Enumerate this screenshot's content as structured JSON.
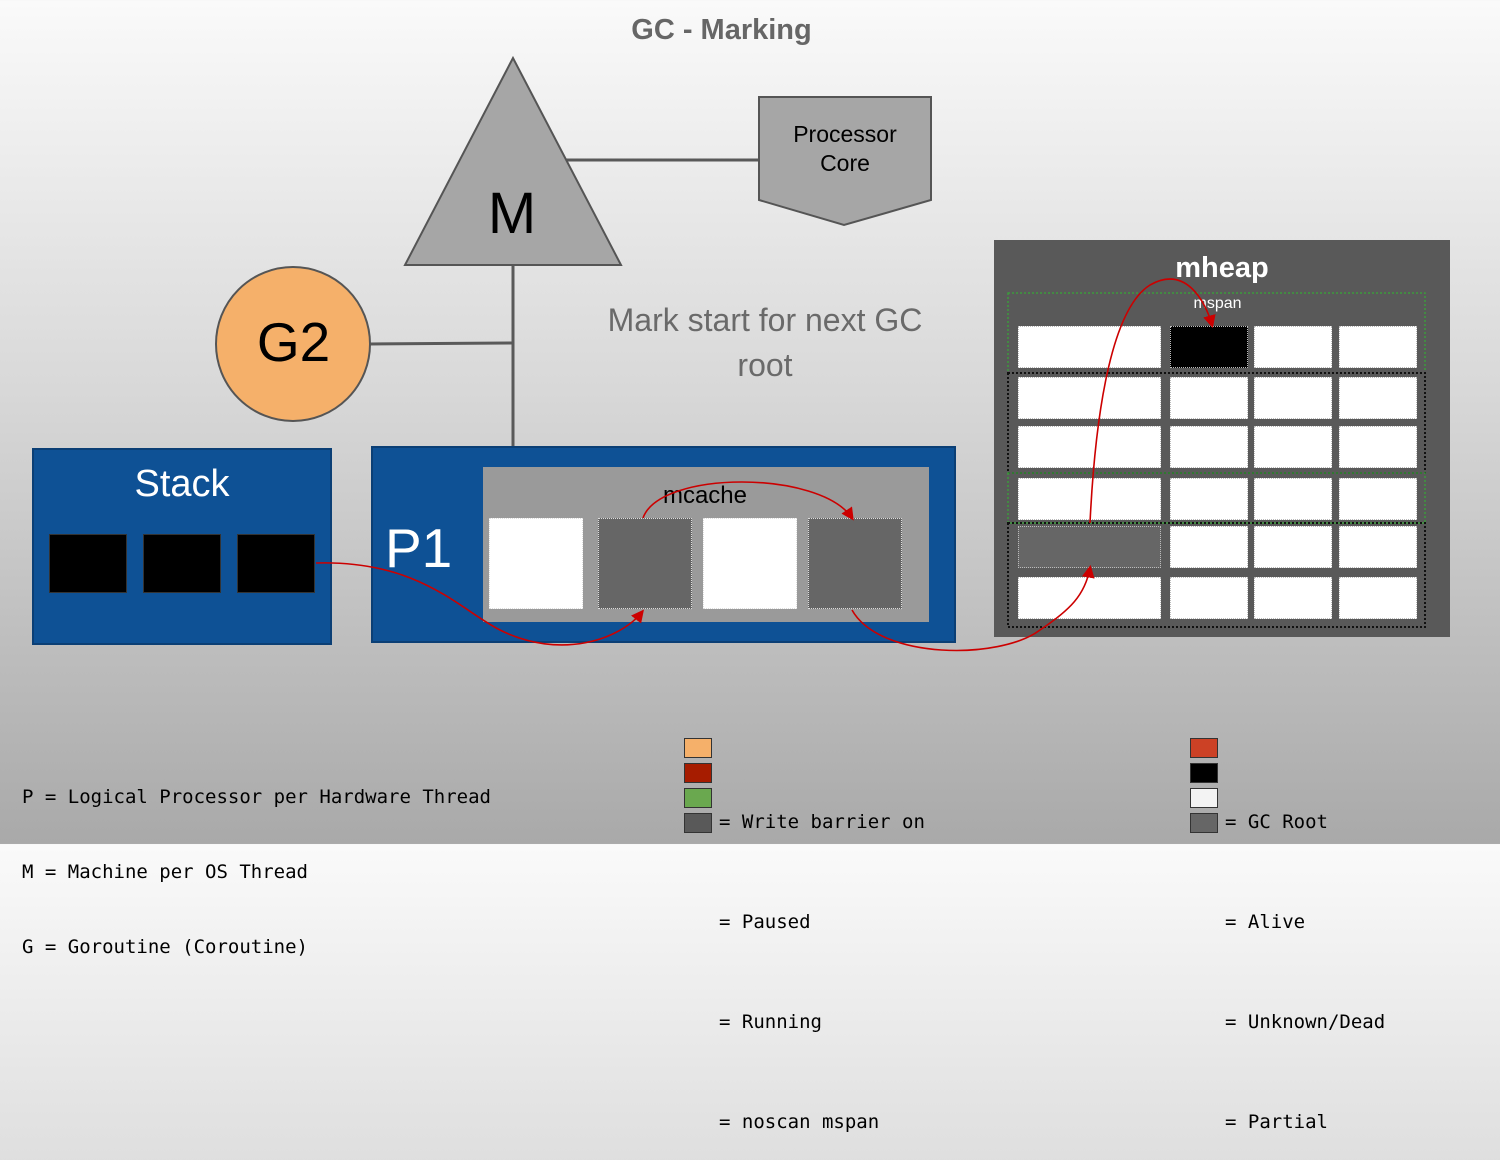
{
  "title": "GC - Marking",
  "processor": {
    "line1": "Processor",
    "line2": "Core"
  },
  "machine": {
    "label": "M"
  },
  "goroutine": {
    "label": "G2",
    "color": "#f5b06a"
  },
  "mark_text": {
    "line1": "Mark start for next GC",
    "line2": "root"
  },
  "stack": {
    "label": "Stack",
    "frames": [
      "#000000",
      "#000000",
      "#000000"
    ]
  },
  "processor_p": {
    "label": "P1"
  },
  "mcache": {
    "label": "mcache",
    "cells": [
      "#ffffff",
      "#666666",
      "#ffffff",
      "#666666"
    ]
  },
  "mheap": {
    "label": "mheap",
    "mspan_label": "mspan",
    "rows": [
      [
        "#ffffff",
        "#000000",
        "#ffffff",
        "#ffffff"
      ],
      [
        "#ffffff",
        "#ffffff",
        "#ffffff",
        "#ffffff"
      ],
      [
        "#ffffff",
        "#ffffff",
        "#ffffff",
        "#ffffff"
      ],
      [
        "#ffffff",
        "#ffffff",
        "#ffffff",
        "#ffffff"
      ],
      [
        "#666666",
        "#ffffff",
        "#ffffff",
        "#ffffff"
      ],
      [
        "#ffffff",
        "#ffffff",
        "#ffffff",
        "#ffffff"
      ]
    ]
  },
  "legend": {
    "definitions": [
      "P = Logical Processor per Hardware Thread",
      "M = Machine per OS Thread",
      "G = Goroutine (Coroutine)"
    ],
    "states": [
      {
        "color": "#f5b06a",
        "text": "= Write barrier on"
      },
      {
        "color": "#a61c00",
        "text": "= Paused"
      },
      {
        "color": "#6aa84f",
        "text": "= Running"
      },
      {
        "color": "#595959",
        "text": "= noscan mspan"
      }
    ],
    "colors": [
      {
        "color": "#cc4125",
        "text": "= GC Root"
      },
      {
        "color": "#000000",
        "text": "= Alive"
      },
      {
        "color": "#f3f3f3",
        "text": "= Unknown/Dead"
      },
      {
        "color": "#666666",
        "text": "= Partial"
      }
    ]
  }
}
